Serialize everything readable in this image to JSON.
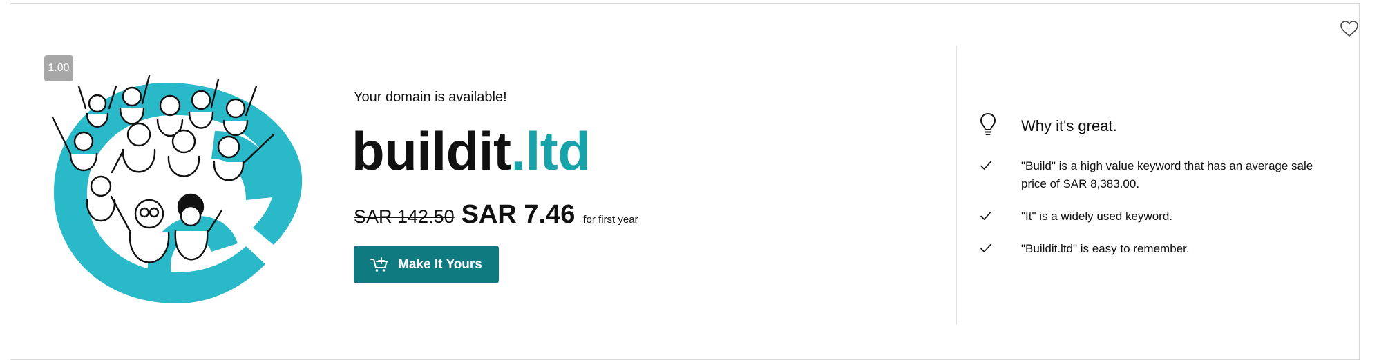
{
  "score": "1.00",
  "status_text": "Your domain is available!",
  "domain": {
    "name": "buildit",
    "tld": ".ltd"
  },
  "pricing": {
    "original": "SAR 142.50",
    "current": "SAR 7.46",
    "term": "for first year"
  },
  "cta": {
    "label": "Make It Yours",
    "icon": "cart-add-icon"
  },
  "why": {
    "title": "Why it's great.",
    "icon": "lightbulb-icon",
    "reasons": [
      "\"Build\" is a high value keyword that has an average sale price of SAR 8,383.00.",
      "\"It\" is a widely used keyword.",
      "\"Buildit.ltd\" is easy to remember."
    ]
  },
  "favorite": {
    "icon": "heart-icon"
  },
  "colors": {
    "accent": "#17a3a9",
    "button": "#0f7b80",
    "score_badge": "#a7a7a7"
  }
}
